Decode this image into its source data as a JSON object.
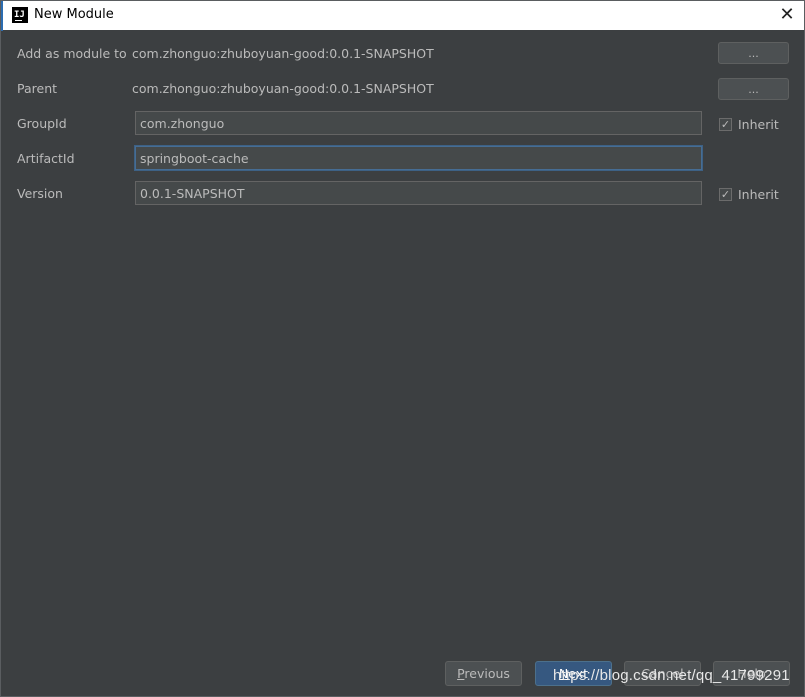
{
  "window": {
    "title": "New Module",
    "app_icon": "intellij-icon",
    "app_icon_text": "IJ",
    "close_glyph": "✕"
  },
  "form": {
    "add_as_module_to": {
      "label": "Add as module to",
      "value": "com.zhonguo:zhuboyuan-good:0.0.1-SNAPSHOT",
      "button": "..."
    },
    "parent": {
      "label": "Parent",
      "value": "com.zhonguo:zhuboyuan-good:0.0.1-SNAPSHOT",
      "button": "..."
    },
    "group_id": {
      "label": "GroupId",
      "value": "com.zhonguo",
      "inherit_label": "Inherit",
      "inherit_checked": true
    },
    "artifact_id": {
      "label": "ArtifactId",
      "value": "springboot-cache"
    },
    "version": {
      "label": "Version",
      "value": "0.0.1-SNAPSHOT",
      "inherit_label": "Inherit",
      "inherit_checked": true
    }
  },
  "footer": {
    "previous": "Previous",
    "next": "Next",
    "cancel": "Cancel",
    "help": "Help"
  },
  "watermark": "https://blog.csdn.net/qq_41799291",
  "colors": {
    "background": "#3c3f41",
    "input_bg": "#45494a",
    "primary": "#365880",
    "focus": "#466d94",
    "text": "#bbbbbb"
  }
}
